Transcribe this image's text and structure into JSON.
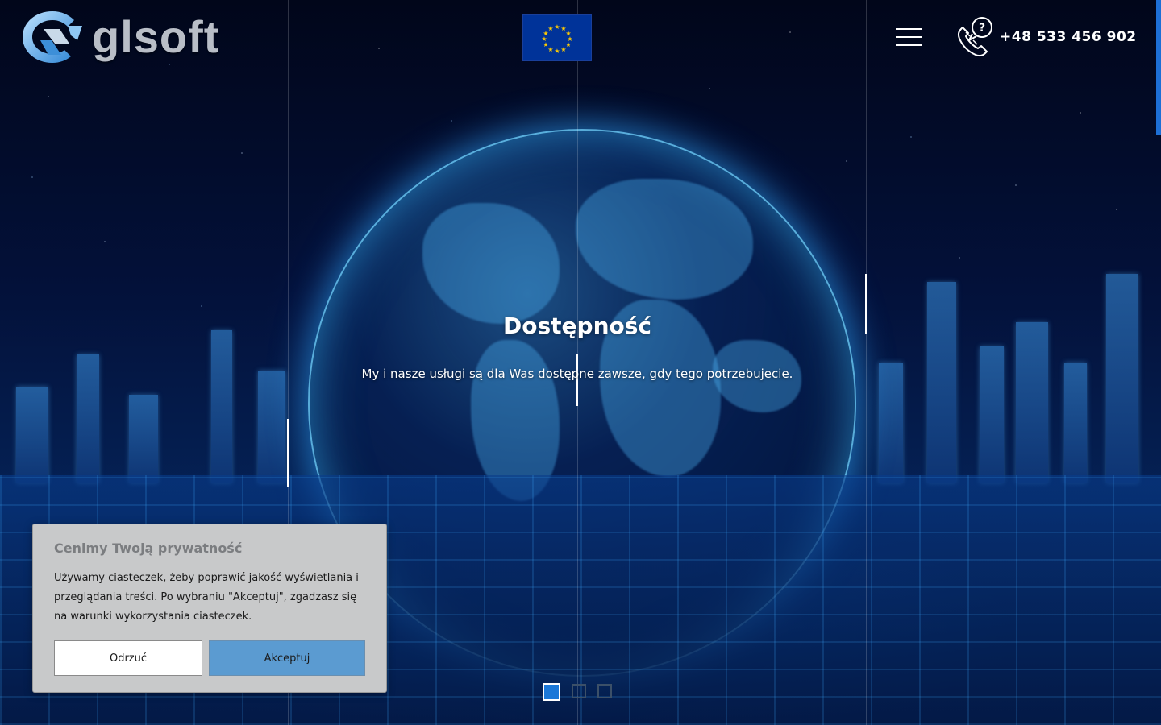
{
  "header": {
    "logo_text": "glsoft",
    "phone": "+48 533 456 902"
  },
  "icons": {
    "logo": "glsoft-logo-mark-icon",
    "eu_flag": "eu-flag-icon",
    "menu": "hamburger-menu-icon",
    "phone": "phone-question-icon"
  },
  "slide": {
    "title": "Dostępność",
    "text": "My i nasze usługi są dla Was dostępne zawsze, gdy tego potrzebujecie."
  },
  "pagination": {
    "count": 3,
    "active_index": 0
  },
  "cookie_banner": {
    "title": "Cenimy Twoją prywatność",
    "text": "Używamy ciasteczek, żeby poprawić jakość wyświetlania i przeglądania treści. Po wybraniu \"Akceptuj\", zgadzasz się na warunki wykorzystania ciasteczek.",
    "reject_label": "Odrzuć",
    "accept_label": "Akceptuj"
  },
  "colors": {
    "accent": "#1b78d8",
    "accept_button": "#5b9bd1",
    "banner_bg": "#c8c9ca",
    "eu_blue": "#003399",
    "eu_gold": "#ffcc00"
  }
}
